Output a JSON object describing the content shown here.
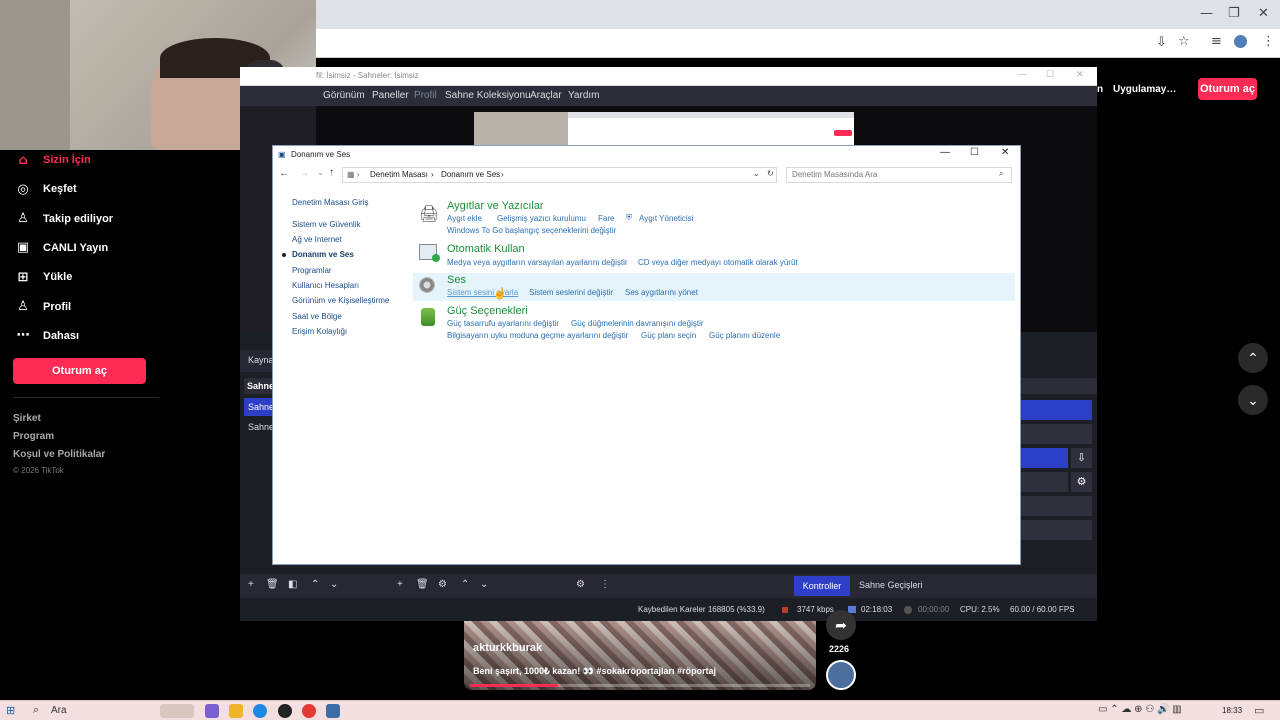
{
  "browser": {
    "install_icon": "install-icon",
    "star_icon": "star-icon",
    "minimize": "—",
    "restore": "❐",
    "close": "✕"
  },
  "tiktok": {
    "nav": [
      {
        "label": "Sizin İçin",
        "icon": "home-icon",
        "active": true
      },
      {
        "label": "Keşfet",
        "icon": "compass-icon",
        "active": false
      },
      {
        "label": "Takip ediliyor",
        "icon": "person-icon",
        "active": false
      },
      {
        "label": "CANLI Yayın",
        "icon": "live-icon",
        "active": false
      },
      {
        "label": "Yükle",
        "icon": "upload-icon",
        "active": false
      },
      {
        "label": "Profil",
        "icon": "profile-icon",
        "active": false
      },
      {
        "label": "Dahası",
        "icon": "more-icon",
        "active": false
      }
    ],
    "login_button": "Oturum aç",
    "footer": [
      "Şirket",
      "Program",
      "Koşul ve Politikalar"
    ],
    "copyright": "© 2026 TikTok",
    "top_app_label": "Uygulamay…",
    "top_login": "Oturum aç",
    "video": {
      "username": "akturkkburak",
      "caption": "Beni şaşırt, 1000₺ kazan! 👀 #sokakröportajları #röportaj",
      "share_count": "2226"
    }
  },
  "obs": {
    "title": "fil: İsimsiz - Sahneler: İsimsiz",
    "menu": [
      "Görünüm",
      "Paneller",
      "Profil",
      "Sahne Koleksiyonu",
      "Araçlar",
      "Yardım"
    ],
    "side_labels": {
      "sources": "Kayna",
      "scenes_header": "Sahne",
      "scene_1": "Sahne",
      "scene_2": "Sahne"
    },
    "tabs": {
      "controls": "Kontroller",
      "transitions": "Sahne Geçişleri"
    },
    "status": {
      "dropped": "Kaybedilen Kareler 168805 (%33.9)",
      "bitrate": "3747 kbps",
      "live_time": "02:18:03",
      "rec_time": "00:00:00",
      "cpu": "CPU: 2.5%",
      "fps": "60.00 / 60.00 FPS"
    }
  },
  "control_panel": {
    "title": "Donanım ve Ses",
    "breadcrumb": [
      "Denetim Masası",
      "Donanım ve Ses"
    ],
    "search_placeholder": "Denetim Masasında Ara",
    "nav": [
      {
        "label": "Denetim Masası Giriş",
        "active": false
      },
      {
        "label": "Sistem ve Güvenlik",
        "active": false
      },
      {
        "label": "Ağ ve Internet",
        "active": false
      },
      {
        "label": "Donanım ve Ses",
        "active": true
      },
      {
        "label": "Programlar",
        "active": false
      },
      {
        "label": "Kullanıcı Hesapları",
        "active": false
      },
      {
        "label": "Görünüm ve Kişiselleştirme",
        "active": false
      },
      {
        "label": "Saat ve Bölge",
        "active": false
      },
      {
        "label": "Erişim Kolaylığı",
        "active": false
      }
    ],
    "sections": [
      {
        "title": "Aygıtlar ve Yazıcılar",
        "icon": "printer-icon",
        "links": [
          [
            "Aygıt ekle",
            "Gelişmiş yazıcı kurulumu",
            "Fare",
            "Aygıt Yöneticisi"
          ],
          [
            "Windows To Go başlangıç seçeneklerini değiştir"
          ]
        ]
      },
      {
        "title": "Otomatik Kullan",
        "icon": "autoplay-icon",
        "links": [
          [
            "Medya veya aygıtların varsayılan ayarlarını değiştir",
            "CD veya diğer medyayı otomatik olarak yürüt"
          ]
        ]
      },
      {
        "title": "Ses",
        "icon": "speaker-icon",
        "links": [
          [
            "Sistem sesini ayarla",
            "Sistem seslerini değiştir",
            "Ses aygıtlarını yönet"
          ]
        ]
      },
      {
        "title": "Güç Seçenekleri",
        "icon": "battery-icon",
        "links": [
          [
            "Güç tasarrufu ayarlarını değiştir",
            "Güç düğmelerinin davranışını değiştir"
          ],
          [
            "Bilgisayarın uyku moduna geçme ayarlarını değiştir",
            "Güç planı seçin",
            "Güç planını düzenle"
          ]
        ]
      }
    ]
  },
  "taskbar": {
    "search": "Ara",
    "time": "18:33"
  },
  "colors": {
    "tiktok_red": "#fe2c55",
    "obs_accent": "#2d3fc7",
    "cp_green": "#1e8f3a",
    "cp_link": "#2a6fb5"
  }
}
